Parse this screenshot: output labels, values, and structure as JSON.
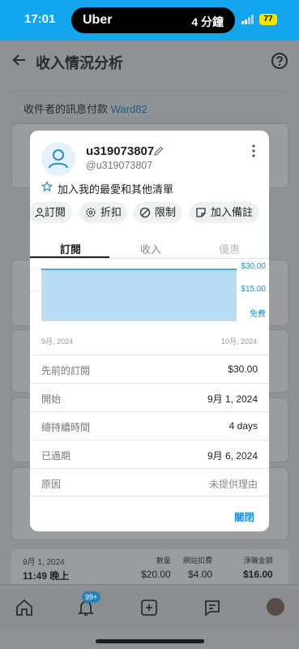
{
  "status_bar": {
    "time": "17:01",
    "activity_app": "Uber",
    "activity_eta": "4 分鐘",
    "battery": "77"
  },
  "screen": {
    "title": "收入情況分析",
    "message_label": "收件者的訊息付款",
    "message_link": "Ward82"
  },
  "background_card": {
    "date": "9月 1, 2024",
    "time": "11:49 晚上",
    "columns": [
      {
        "header": "數量",
        "value": "$20.00"
      },
      {
        "header": "網站扣費",
        "value": "$4.00"
      },
      {
        "header": "淨賺金額",
        "value": "$16.00"
      }
    ]
  },
  "tab_bar": {
    "notification_badge": "99+"
  },
  "modal": {
    "username": "u319073807",
    "handle": "@u319073807",
    "favorite_label": "加入我的最愛和其他清單",
    "actions": [
      "訂閱",
      "折扣",
      "限制",
      "加入備註"
    ],
    "tabs": [
      "訂閱",
      "收入",
      "優惠"
    ],
    "active_tab": "訂閱",
    "details": [
      {
        "label": "先前的訂閱",
        "value": "$30.00"
      },
      {
        "label": "開始",
        "value": "9月 1, 2024"
      },
      {
        "label": "總持續時間",
        "value": "4 days"
      },
      {
        "label": "已過期",
        "value": "9月 6, 2024"
      },
      {
        "label": "原因",
        "value": "未提供理由"
      }
    ],
    "close_label": "關閉"
  },
  "chart_data": {
    "type": "area",
    "y_tick_labels": [
      "$30.00",
      "$15.00",
      "免費"
    ],
    "x_tick_labels": [
      "9月, 2024",
      "10月, 2024"
    ],
    "ylim": [
      0,
      30
    ],
    "series": [
      {
        "x": [
          "9月, 2024",
          "10月, 2024"
        ],
        "values": [
          30,
          30
        ]
      }
    ],
    "accent_color": "#2a8fc4",
    "fill_color": "#b9ddf3"
  }
}
